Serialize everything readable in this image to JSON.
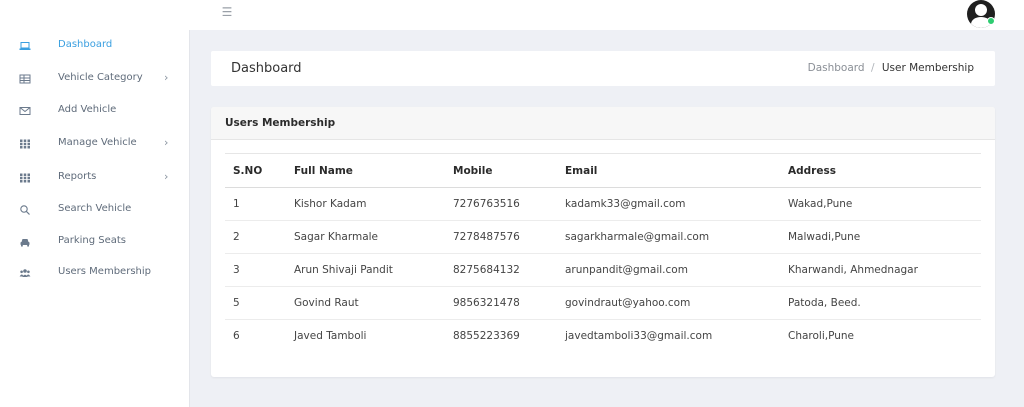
{
  "topbar": {
    "menu_icon": "hamburger-icon",
    "avatar_icon": "user-avatar-icon",
    "status_color": "#2ecc71"
  },
  "sidebar": {
    "accent_color": "#3a9fe0",
    "items": [
      {
        "label": "Dashboard",
        "icon": "laptop-icon",
        "active": true,
        "has_submenu": false
      },
      {
        "label": "Vehicle Category",
        "icon": "table-icon",
        "active": false,
        "has_submenu": true
      },
      {
        "label": "Add Vehicle",
        "icon": "envelope-icon",
        "active": false,
        "has_submenu": false
      },
      {
        "label": "Manage Vehicle",
        "icon": "grid-icon",
        "active": false,
        "has_submenu": true
      },
      {
        "label": "Reports",
        "icon": "grid-icon",
        "active": false,
        "has_submenu": true
      },
      {
        "label": "Search Vehicle",
        "icon": "search-icon",
        "active": false,
        "has_submenu": false
      },
      {
        "label": "Parking Seats",
        "icon": "car-icon",
        "active": false,
        "has_submenu": false
      },
      {
        "label": "Users Membership",
        "icon": "users-icon",
        "active": false,
        "has_submenu": false
      }
    ]
  },
  "header": {
    "title": "Dashboard",
    "breadcrumb": {
      "home": "Dashboard",
      "separator": "/",
      "current": "User Membership"
    }
  },
  "card": {
    "title": "Users Membership",
    "columns": [
      "S.NO",
      "Full Name",
      "Mobile",
      "Email",
      "Address"
    ],
    "rows": [
      [
        "1",
        "Kishor Kadam",
        "7276763516",
        "kadamk33@gmail.com",
        "Wakad,Pune"
      ],
      [
        "2",
        "Sagar Kharmale",
        "7278487576",
        "sagarkharmale@gmail.com",
        "Malwadi,Pune"
      ],
      [
        "3",
        "Arun Shivaji Pandit",
        "8275684132",
        "arunpandit@gmail.com",
        "Kharwandi, Ahmednagar"
      ],
      [
        "5",
        "Govind Raut",
        "9856321478",
        "govindraut@yahoo.com",
        "Patoda, Beed."
      ],
      [
        "6",
        "Javed Tamboli",
        "8855223369",
        "javedtamboli33@gmail.com",
        "Charoli,Pune"
      ]
    ]
  }
}
